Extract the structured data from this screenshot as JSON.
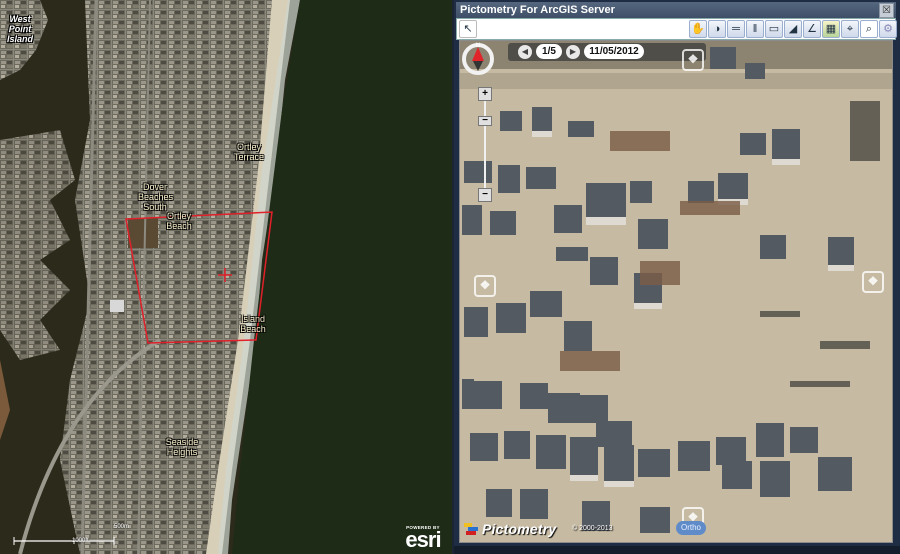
{
  "map": {
    "labels": {
      "west_point_island": "West Point Island",
      "ortley_terrace": "Ortley Terrace",
      "dover_beaches_south": "Dover Beaches South",
      "ortley_beach": "Ortley Beach",
      "island_beach": "Island Beach",
      "seaside_heights": "Seaside Heights"
    },
    "scale": {
      "top_label": "500m",
      "bottom_label": "1000ft"
    },
    "attribution": {
      "powered_by": "POWERED BY",
      "brand": "esri"
    },
    "footprint_color": "#e0202a"
  },
  "panel": {
    "title": "Pictometry For ArcGIS Server",
    "close_label": "☒",
    "toolbar": {
      "select_tool": "select-arrow",
      "tools": [
        {
          "name": "pan-tool",
          "glyph": "✋"
        },
        {
          "name": "globe-tool",
          "glyph": "◑"
        },
        {
          "name": "measure-distance-tool",
          "glyph": "═"
        },
        {
          "name": "measure-height-tool",
          "glyph": "‖"
        },
        {
          "name": "measure-area-tool",
          "glyph": "▭"
        },
        {
          "name": "measure-elevation-tool",
          "glyph": "◢"
        },
        {
          "name": "measure-bearing-tool",
          "glyph": "∠"
        },
        {
          "name": "overlay-tool",
          "glyph": "▦"
        },
        {
          "name": "zoom-to-point-tool",
          "glyph": "⌖"
        },
        {
          "name": "zoom-tool",
          "glyph": "⌕"
        }
      ],
      "settings_glyph": "⚙"
    },
    "viewer": {
      "compass_label": "N",
      "prev_label": "◀",
      "next_label": "▶",
      "image_index": "1/5",
      "date": "11/05/2012",
      "zoom_in": "+",
      "zoom_out": "−",
      "zoom_level": 0.8,
      "logo": "Pictometry",
      "copyright": "© 2000-2013",
      "view_mode": "Ortho",
      "pan_glyph": "❖"
    }
  }
}
